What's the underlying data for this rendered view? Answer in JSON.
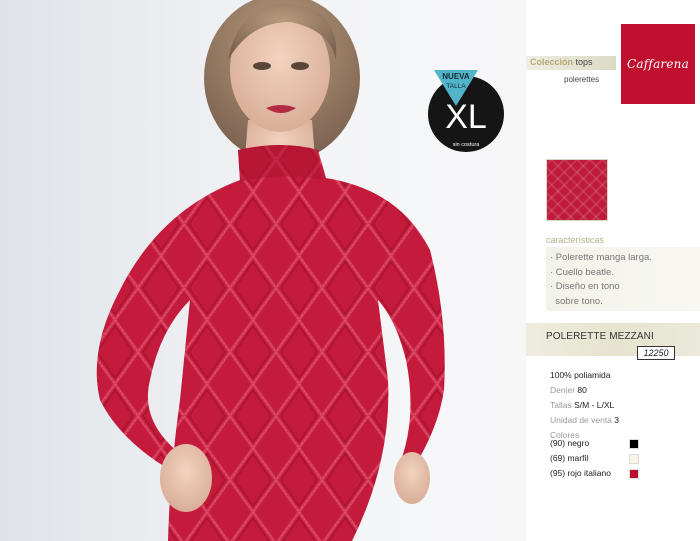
{
  "badge": {
    "nueva": "NUEVA",
    "talla": "TALLA",
    "size": "XL",
    "footer": "sin costura"
  },
  "brand": {
    "logo": "Caffarena",
    "accent_color": "#c0102f"
  },
  "collection": {
    "word": "Colección",
    "category": "tops",
    "subcategory": "polerettes"
  },
  "features": {
    "label": "características",
    "items": [
      "· Polerette manga larga.",
      "· Cuello beatle.",
      "· Diseño en tono",
      "  sobre tono."
    ]
  },
  "product": {
    "name": "POLERETTE MEZZANI",
    "code": "12250"
  },
  "specs": {
    "material": "100% poliamida",
    "denier_label": "Denier",
    "denier_value": "80",
    "tallas_label": "Tallas",
    "tallas_value": "S/M - L/XL",
    "unidad_label": "Unidad de venta",
    "unidad_value": "3",
    "colores_label": "Colores"
  },
  "colors": [
    {
      "label": "(90) negro",
      "hex": "#000000"
    },
    {
      "label": "(69) marfil",
      "hex": "#fbf3e8"
    },
    {
      "label": "(95) rojo italiano",
      "hex": "#b8102e"
    }
  ]
}
